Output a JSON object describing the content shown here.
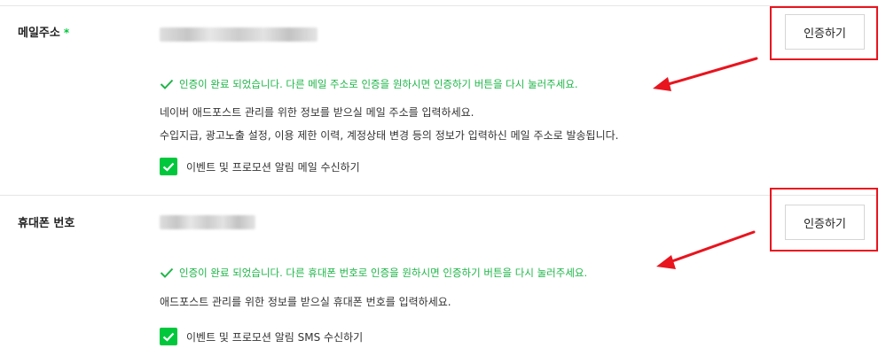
{
  "email": {
    "label": "메일주소",
    "required_mark": "*",
    "verify_button_label": "인증하기",
    "success_message": "인증이 완료 되었습니다. 다른 메일 주소로 인증을 원하시면 인증하기 버튼을 다시 눌러주세요.",
    "description": [
      "네이버 애드포스트 관리를 위한 정보를 받으실 메일 주소를 입력하세요.",
      "수입지급, 광고노출 설정, 이용 제한 이력, 계정상태 변경 등의 정보가 입력하신 메일 주소로 발송됩니다."
    ],
    "checkbox_label": "이벤트 및 프로모션 알림 메일 수신하기",
    "checkbox_checked": true
  },
  "phone": {
    "label": "휴대폰 번호",
    "verify_button_label": "인증하기",
    "success_message": "인증이 완료 되었습니다. 다른 휴대폰 번호로 인증을 원하시면 인증하기 버튼을 다시 눌러주세요.",
    "description": [
      "애드포스트 관리를 위한 정보를 받으실 휴대폰 번호를 입력하세요."
    ],
    "checkbox_label": "이벤트 및 프로모션 알림 SMS 수신하기",
    "checkbox_checked": true
  },
  "colors": {
    "success_green": "#1eb548",
    "checkbox_green": "#00c73c",
    "highlight_red": "#e8141e"
  }
}
